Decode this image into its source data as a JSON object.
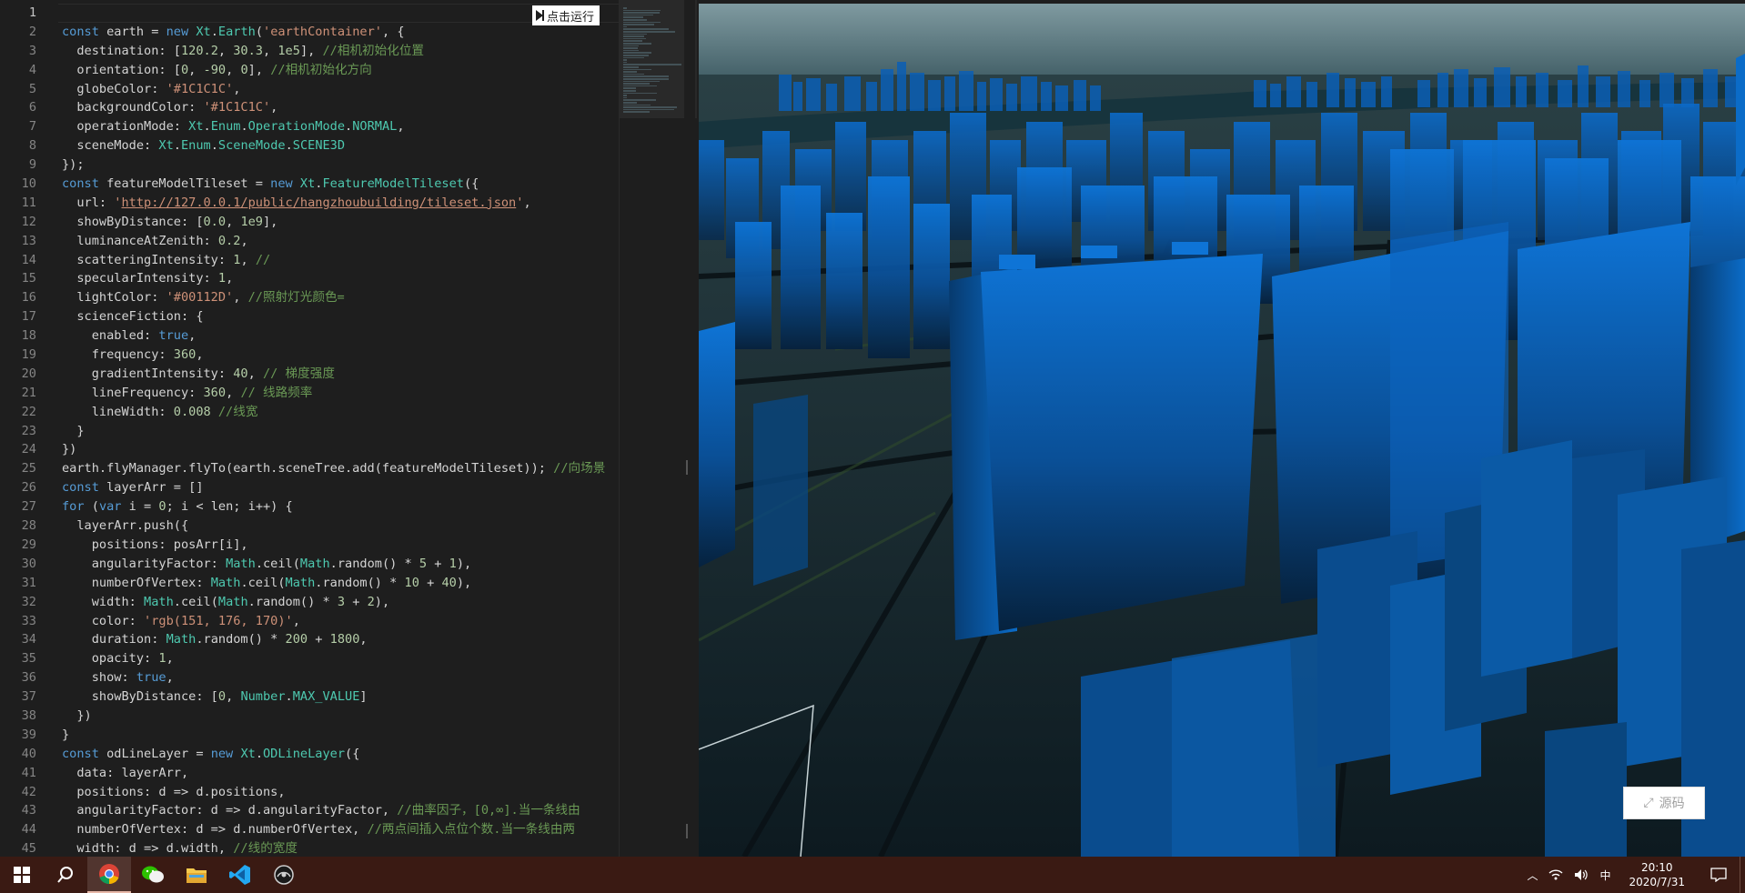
{
  "editor": {
    "run_button_label": "点击运行",
    "active_line": 1,
    "lines": [
      {
        "n": "1",
        "html": ""
      },
      {
        "n": "2",
        "html": "<span class='k'>const</span> earth = <span class='k'>new</span> <span class='c'>Xt</span>.<span class='c'>Earth</span>(<span class='s'>'earthContainer'</span>, {"
      },
      {
        "n": "3",
        "html": "  destination: [<span class='n'>120.2</span>, <span class='n'>30.3</span>, <span class='n'>1e5</span>], <span class='cm'>//相机初始化位置</span>"
      },
      {
        "n": "4",
        "html": "  orientation: [<span class='n'>0</span>, <span class='n'>-90</span>, <span class='n'>0</span>], <span class='cm'>//相机初始化方向</span>"
      },
      {
        "n": "5",
        "html": "  globeColor: <span class='s'>'#1C1C1C'</span>,"
      },
      {
        "n": "6",
        "html": "  backgroundColor: <span class='s'>'#1C1C1C'</span>,"
      },
      {
        "n": "7",
        "html": "  operationMode: <span class='c'>Xt</span>.<span class='c'>Enum</span>.<span class='c'>OperationMode</span>.<span class='c'>NORMAL</span>,"
      },
      {
        "n": "8",
        "html": "  sceneMode: <span class='c'>Xt</span>.<span class='c'>Enum</span>.<span class='c'>SceneMode</span>.<span class='c'>SCENE3D</span>"
      },
      {
        "n": "9",
        "html": "});"
      },
      {
        "n": "10",
        "html": "<span class='k'>const</span> featureModelTileset = <span class='k'>new</span> <span class='c'>Xt</span>.<span class='c'>FeatureModelTileset</span>({"
      },
      {
        "n": "11",
        "html": "  url: <span class='s'>'</span><span class='u'>http://127.0.0.1/public/hangzhoubuilding/tileset.json</span><span class='s'>'</span>,"
      },
      {
        "n": "12",
        "html": "  showByDistance: [<span class='n'>0.0</span>, <span class='n'>1e9</span>],"
      },
      {
        "n": "13",
        "html": "  luminanceAtZenith: <span class='n'>0.2</span>,"
      },
      {
        "n": "14",
        "html": "  scatteringIntensity: <span class='n'>1</span>, <span class='cm'>//</span>"
      },
      {
        "n": "15",
        "html": "  specularIntensity: <span class='n'>1</span>,"
      },
      {
        "n": "16",
        "html": "  lightColor: <span class='s'>'#00112D'</span>, <span class='cm'>//照射灯光颜色=</span>"
      },
      {
        "n": "17",
        "html": "  scienceFiction: {"
      },
      {
        "n": "18",
        "html": "    enabled: <span class='k'>true</span>,"
      },
      {
        "n": "19",
        "html": "    frequency: <span class='n'>360</span>,"
      },
      {
        "n": "20",
        "html": "    gradientIntensity: <span class='n'>40</span>, <span class='cm'>// 梯度强度</span>"
      },
      {
        "n": "21",
        "html": "    lineFrequency: <span class='n'>360</span>, <span class='cm'>// 线路频率</span>"
      },
      {
        "n": "22",
        "html": "    lineWidth: <span class='n'>0.008</span> <span class='cm'>//线宽</span>"
      },
      {
        "n": "23",
        "html": "  }"
      },
      {
        "n": "24",
        "html": "})"
      },
      {
        "n": "25",
        "html": "earth.flyManager.flyTo(earth.sceneTree.add(featureModelTileset)); <span class='cm'>//向场景</span>"
      },
      {
        "n": "26",
        "html": "<span class='k'>const</span> layerArr = []"
      },
      {
        "n": "27",
        "html": "<span class='k'>for</span> (<span class='k'>var</span> i = <span class='n'>0</span>; i &lt; len; i++) {"
      },
      {
        "n": "28",
        "html": "  layerArr.push({"
      },
      {
        "n": "29",
        "html": "    positions: posArr[i],"
      },
      {
        "n": "30",
        "html": "    angularityFactor: <span class='c'>Math</span>.ceil(<span class='c'>Math</span>.random() * <span class='n'>5</span> + <span class='n'>1</span>),"
      },
      {
        "n": "31",
        "html": "    numberOfVertex: <span class='c'>Math</span>.ceil(<span class='c'>Math</span>.random() * <span class='n'>10</span> + <span class='n'>40</span>),"
      },
      {
        "n": "32",
        "html": "    width: <span class='c'>Math</span>.ceil(<span class='c'>Math</span>.random() * <span class='n'>3</span> + <span class='n'>2</span>),"
      },
      {
        "n": "33",
        "html": "    color: <span class='s'>'rgb(151, 176, 170)'</span>,"
      },
      {
        "n": "34",
        "html": "    duration: <span class='c'>Math</span>.random() * <span class='n'>200</span> + <span class='n'>1800</span>,"
      },
      {
        "n": "35",
        "html": "    opacity: <span class='n'>1</span>,"
      },
      {
        "n": "36",
        "html": "    show: <span class='k'>true</span>,"
      },
      {
        "n": "37",
        "html": "    showByDistance: [<span class='n'>0</span>, <span class='c'>Number</span>.<span class='c'>MAX_VALUE</span>]"
      },
      {
        "n": "38",
        "html": "  })"
      },
      {
        "n": "39",
        "html": "}"
      },
      {
        "n": "40",
        "html": "<span class='k'>const</span> odLineLayer = <span class='k'>new</span> <span class='c'>Xt</span>.<span class='c'>ODLineLayer</span>({"
      },
      {
        "n": "41",
        "html": "  data: layerArr,"
      },
      {
        "n": "42",
        "html": "  positions: d =&gt; d.positions,"
      },
      {
        "n": "43",
        "html": "  angularityFactor: d =&gt; d.angularityFactor, <span class='cm'>//曲率因子，[0,∞].当一条线由</span>"
      },
      {
        "n": "44",
        "html": "  numberOfVertex: d =&gt; d.numberOfVertex, <span class='cm'>//两点间插入点位个数.当一条线由两</span>"
      },
      {
        "n": "45",
        "html": "  width: d =&gt; d.width, <span class='cm'>//线的宽度</span>"
      }
    ]
  },
  "viewport": {
    "source_button_label": "源码",
    "sky_color": "#4a6a6f",
    "building_color": "#0b5fb5"
  },
  "taskbar": {
    "apps": [
      {
        "name": "windows-start-icon",
        "active": false
      },
      {
        "name": "search-icon",
        "active": false
      },
      {
        "name": "chrome-icon",
        "active": true
      },
      {
        "name": "wechat-icon",
        "active": false
      },
      {
        "name": "file-explorer-icon",
        "active": false
      },
      {
        "name": "vscode-icon",
        "active": false
      },
      {
        "name": "app-icon",
        "active": false
      }
    ],
    "tray": {
      "ime": "中",
      "time": "20:10",
      "date": "2020/7/31"
    }
  }
}
